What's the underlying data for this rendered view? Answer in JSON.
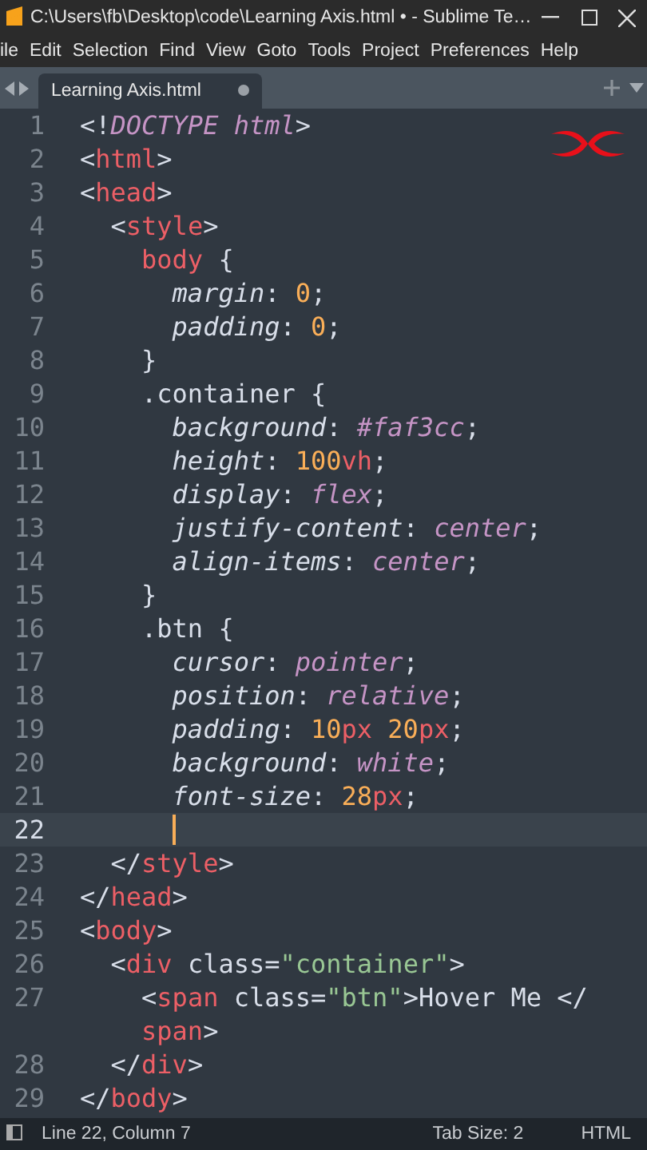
{
  "window": {
    "title": "C:\\Users\\fb\\Desktop\\code\\Learning Axis.html • - Sublime Te…"
  },
  "menu": [
    "ile",
    "Edit",
    "Selection",
    "Find",
    "View",
    "Goto",
    "Tools",
    "Project",
    "Preferences",
    "Help"
  ],
  "tabs": [
    {
      "label": "Learning Axis.html",
      "selected": true,
      "dirty": true
    }
  ],
  "lines": [
    {
      "number": "1",
      "current": false,
      "tokens": [
        {
          "kind": "punct",
          "text": "<!"
        },
        {
          "kind": "kw",
          "text": "DOCTYPE html"
        },
        {
          "kind": "punct",
          "text": ">"
        }
      ]
    },
    {
      "number": "2",
      "current": false,
      "tokens": [
        {
          "kind": "punct",
          "text": "<"
        },
        {
          "kind": "tag",
          "text": "html"
        },
        {
          "kind": "punct",
          "text": ">"
        }
      ]
    },
    {
      "number": "3",
      "current": false,
      "tokens": [
        {
          "kind": "punct",
          "text": "<"
        },
        {
          "kind": "tag",
          "text": "head"
        },
        {
          "kind": "punct",
          "text": ">"
        }
      ]
    },
    {
      "number": "4",
      "current": false,
      "tokens": [
        {
          "kind": "punct",
          "text": "  <"
        },
        {
          "kind": "tag",
          "text": "style"
        },
        {
          "kind": "punct",
          "text": ">"
        }
      ]
    },
    {
      "number": "5",
      "current": false,
      "tokens": [
        {
          "kind": "tag",
          "text": "    body"
        },
        {
          "kind": "punct",
          "text": " {"
        }
      ]
    },
    {
      "number": "6",
      "current": false,
      "tokens": [
        {
          "kind": "prop",
          "text": "      margin"
        },
        {
          "kind": "punct",
          "text": ": "
        },
        {
          "kind": "num",
          "text": "0"
        },
        {
          "kind": "punct",
          "text": ";"
        }
      ]
    },
    {
      "number": "7",
      "current": false,
      "tokens": [
        {
          "kind": "prop",
          "text": "      padding"
        },
        {
          "kind": "punct",
          "text": ": "
        },
        {
          "kind": "num",
          "text": "0"
        },
        {
          "kind": "punct",
          "text": ";"
        }
      ]
    },
    {
      "number": "8",
      "current": false,
      "tokens": [
        {
          "kind": "punct",
          "text": "    }"
        }
      ]
    },
    {
      "number": "9",
      "current": false,
      "tokens": [
        {
          "kind": "sel",
          "text": "    .container"
        },
        {
          "kind": "punct",
          "text": " {"
        }
      ]
    },
    {
      "number": "10",
      "current": false,
      "tokens": [
        {
          "kind": "prop",
          "text": "      background"
        },
        {
          "kind": "punct",
          "text": ": "
        },
        {
          "kind": "const",
          "text": "#faf3cc"
        },
        {
          "kind": "punct",
          "text": ";"
        }
      ]
    },
    {
      "number": "11",
      "current": false,
      "tokens": [
        {
          "kind": "prop",
          "text": "      height"
        },
        {
          "kind": "punct",
          "text": ": "
        },
        {
          "kind": "num",
          "text": "100"
        },
        {
          "kind": "unit",
          "text": "vh"
        },
        {
          "kind": "punct",
          "text": ";"
        }
      ]
    },
    {
      "number": "12",
      "current": false,
      "tokens": [
        {
          "kind": "prop",
          "text": "      display"
        },
        {
          "kind": "punct",
          "text": ": "
        },
        {
          "kind": "kw",
          "text": "flex"
        },
        {
          "kind": "punct",
          "text": ";"
        }
      ]
    },
    {
      "number": "13",
      "current": false,
      "tokens": [
        {
          "kind": "prop",
          "text": "      justify-content"
        },
        {
          "kind": "punct",
          "text": ": "
        },
        {
          "kind": "kw",
          "text": "center"
        },
        {
          "kind": "punct",
          "text": ";"
        }
      ]
    },
    {
      "number": "14",
      "current": false,
      "tokens": [
        {
          "kind": "prop",
          "text": "      align-items"
        },
        {
          "kind": "punct",
          "text": ": "
        },
        {
          "kind": "kw",
          "text": "center"
        },
        {
          "kind": "punct",
          "text": ";"
        }
      ]
    },
    {
      "number": "15",
      "current": false,
      "tokens": [
        {
          "kind": "punct",
          "text": "    }"
        }
      ]
    },
    {
      "number": "16",
      "current": false,
      "tokens": [
        {
          "kind": "sel",
          "text": "    .btn"
        },
        {
          "kind": "punct",
          "text": " {"
        }
      ]
    },
    {
      "number": "17",
      "current": false,
      "tokens": [
        {
          "kind": "prop",
          "text": "      cursor"
        },
        {
          "kind": "punct",
          "text": ": "
        },
        {
          "kind": "kw",
          "text": "pointer"
        },
        {
          "kind": "punct",
          "text": ";"
        }
      ]
    },
    {
      "number": "18",
      "current": false,
      "tokens": [
        {
          "kind": "prop",
          "text": "      position"
        },
        {
          "kind": "punct",
          "text": ": "
        },
        {
          "kind": "kw",
          "text": "relative"
        },
        {
          "kind": "punct",
          "text": ";"
        }
      ]
    },
    {
      "number": "19",
      "current": false,
      "tokens": [
        {
          "kind": "prop",
          "text": "      padding"
        },
        {
          "kind": "punct",
          "text": ": "
        },
        {
          "kind": "num",
          "text": "10"
        },
        {
          "kind": "unit",
          "text": "px"
        },
        {
          "kind": "num",
          "text": " 20"
        },
        {
          "kind": "unit",
          "text": "px"
        },
        {
          "kind": "punct",
          "text": ";"
        }
      ]
    },
    {
      "number": "20",
      "current": false,
      "tokens": [
        {
          "kind": "prop",
          "text": "      background"
        },
        {
          "kind": "punct",
          "text": ": "
        },
        {
          "kind": "kw",
          "text": "white"
        },
        {
          "kind": "punct",
          "text": ";"
        }
      ]
    },
    {
      "number": "21",
      "current": false,
      "tokens": [
        {
          "kind": "prop",
          "text": "      font-size"
        },
        {
          "kind": "punct",
          "text": ": "
        },
        {
          "kind": "num",
          "text": "28"
        },
        {
          "kind": "unit",
          "text": "px"
        },
        {
          "kind": "punct",
          "text": ";"
        }
      ]
    },
    {
      "number": "22",
      "current": true
    },
    {
      "number": "23",
      "current": false,
      "tokens": [
        {
          "kind": "punct",
          "text": "  </"
        },
        {
          "kind": "tag",
          "text": "style"
        },
        {
          "kind": "punct",
          "text": ">"
        }
      ]
    },
    {
      "number": "24",
      "current": false,
      "tokens": [
        {
          "kind": "punct",
          "text": "</"
        },
        {
          "kind": "tag",
          "text": "head"
        },
        {
          "kind": "punct",
          "text": ">"
        }
      ]
    },
    {
      "number": "25",
      "current": false,
      "tokens": [
        {
          "kind": "punct",
          "text": "<"
        },
        {
          "kind": "tag",
          "text": "body"
        },
        {
          "kind": "punct",
          "text": ">"
        }
      ]
    },
    {
      "number": "26",
      "current": false,
      "tokens": [
        {
          "kind": "punct",
          "text": "  <"
        },
        {
          "kind": "tag",
          "text": "div"
        },
        {
          "kind": "attr",
          "text": " class"
        },
        {
          "kind": "punct",
          "text": "="
        },
        {
          "kind": "str",
          "text": "\"container\""
        },
        {
          "kind": "punct",
          "text": ">"
        }
      ]
    },
    {
      "number": "27",
      "current": false,
      "tokens": [
        {
          "kind": "punct",
          "text": "    <"
        },
        {
          "kind": "tag",
          "text": "span"
        },
        {
          "kind": "attr",
          "text": " class"
        },
        {
          "kind": "punct",
          "text": "="
        },
        {
          "kind": "str",
          "text": "\"btn\""
        },
        {
          "kind": "punct",
          "text": ">Hover Me </"
        }
      ],
      "wrap": [
        {
          "kind": "tag",
          "text": "    span"
        },
        {
          "kind": "punct",
          "text": ">"
        }
      ]
    },
    {
      "number": "28",
      "current": false,
      "tokens": [
        {
          "kind": "punct",
          "text": "  </"
        },
        {
          "kind": "tag",
          "text": "div"
        },
        {
          "kind": "punct",
          "text": ">"
        }
      ]
    },
    {
      "number": "29",
      "current": false,
      "tokens": [
        {
          "kind": "punct",
          "text": "</"
        },
        {
          "kind": "tag",
          "text": "body"
        },
        {
          "kind": "punct",
          "text": ">"
        }
      ]
    }
  ],
  "status_bar": {
    "position": "Line 22, Column 7",
    "tab_size": "Tab Size: 2",
    "syntax": "HTML"
  }
}
